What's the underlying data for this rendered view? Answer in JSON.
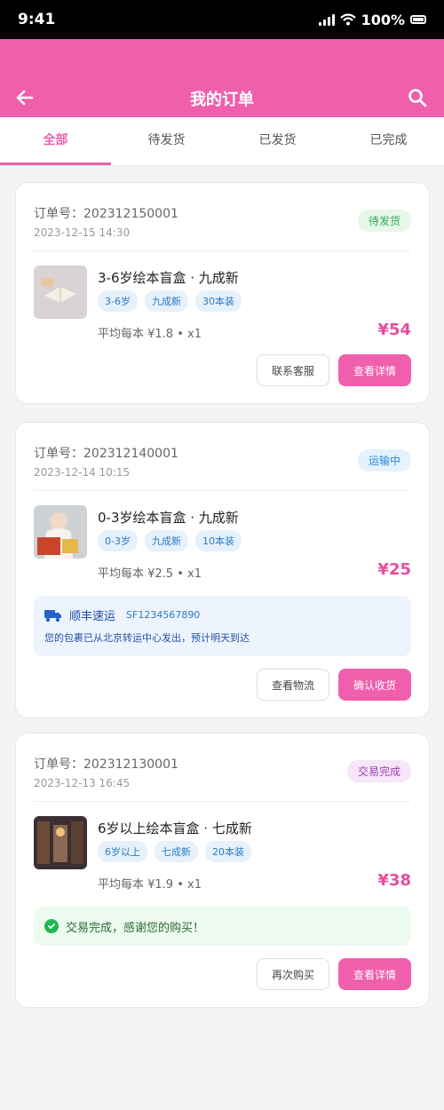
{
  "status_bar": {
    "time": "9:41",
    "battery": "100%"
  },
  "header": {
    "title": "我的订单"
  },
  "tabs": [
    {
      "label": "全部",
      "active": true
    },
    {
      "label": "待发货"
    },
    {
      "label": "已发货"
    },
    {
      "label": "已完成"
    }
  ],
  "orders": [
    {
      "order_no": "订单号：202312150001",
      "time": "2023-12-15 14:30",
      "status": "待发货",
      "product": "3-6岁绘本盲盒 · 九成新",
      "tags": [
        "3-6岁",
        "九成新",
        "30本装"
      ],
      "meta": "平均每本 ¥1.8 • x1",
      "price": "¥54",
      "actions": [
        "联系客服",
        "查看详情"
      ]
    },
    {
      "order_no": "订单号：202312140001",
      "time": "2023-12-14 10:15",
      "status": "运输中",
      "product": "0-3岁绘本盲盒 · 九成新",
      "tags": [
        "0-3岁",
        "九成新",
        "10本装"
      ],
      "meta": "平均每本 ¥2.5 • x1",
      "price": "¥25",
      "logistics": {
        "carrier": "顺丰速运",
        "tracking": "SF1234567890",
        "message": "您的包裹已从北京转运中心发出，预计明天到达"
      },
      "actions": [
        "查看物流",
        "确认收货"
      ]
    },
    {
      "order_no": "订单号：202312130001",
      "time": "2023-12-13 16:45",
      "status": "交易完成",
      "product": "6岁以上绘本盲盒 · 七成新",
      "tags": [
        "6岁以上",
        "七成新",
        "20本装"
      ],
      "meta": "平均每本 ¥1.9 • x1",
      "price": "¥38",
      "completion": "交易完成，感谢您的购买！",
      "actions": [
        "再次购买",
        "查看详情"
      ]
    }
  ],
  "colors": {
    "accent": "#f05fac",
    "price": "#e84d9e"
  }
}
